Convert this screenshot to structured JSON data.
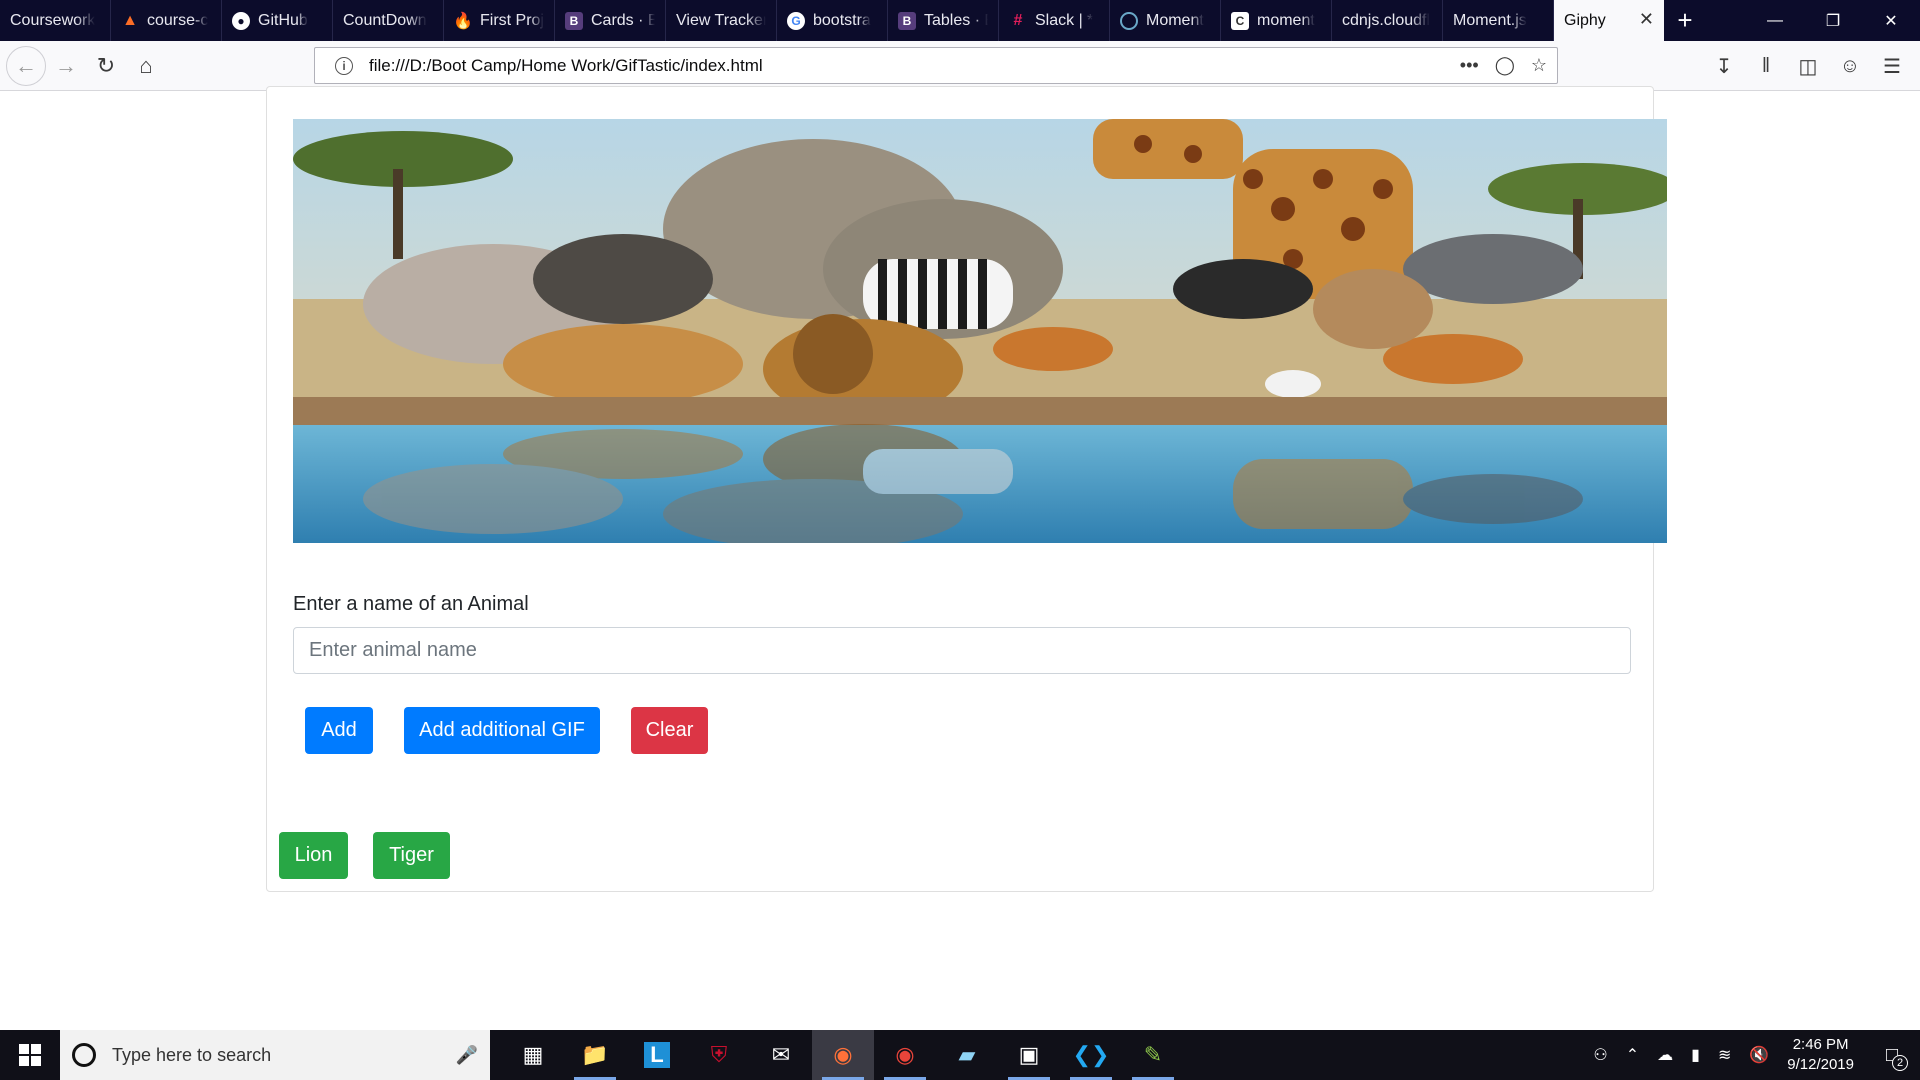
{
  "browser": {
    "tabs": [
      {
        "label": "Coursework",
        "icon": "none"
      },
      {
        "label": "course-c",
        "icon": "gitlab-icon"
      },
      {
        "label": "GitHub",
        "icon": "github-icon"
      },
      {
        "label": "CountDown",
        "icon": "none"
      },
      {
        "label": "First Proj",
        "icon": "firebase-icon"
      },
      {
        "label": "Cards · B",
        "icon": "bootstrap-icon"
      },
      {
        "label": "View Tracker",
        "icon": "none"
      },
      {
        "label": "bootstra",
        "icon": "google-icon"
      },
      {
        "label": "Tables · E",
        "icon": "bootstrap-icon"
      },
      {
        "label": "Slack | *",
        "icon": "slack-icon"
      },
      {
        "label": "Moment",
        "icon": "clock-icon"
      },
      {
        "label": "moment",
        "icon": "c-icon"
      },
      {
        "label": "cdnjs.cloudfl",
        "icon": "none"
      },
      {
        "label": "Moment.js",
        "icon": "none"
      }
    ],
    "active_tab": {
      "label": "Giphy"
    },
    "url": "file:///D:/Boot Camp/Home Work/GifTastic/index.html"
  },
  "page": {
    "form": {
      "label": "Enter a name of an Animal",
      "placeholder": "Enter animal name",
      "add_label": "Add",
      "add_more_label": "Add additional GIF",
      "clear_label": "Clear"
    },
    "animal_buttons": [
      "Lion",
      "Tiger"
    ]
  },
  "taskbar": {
    "search_placeholder": "Type here to search",
    "time": "2:46 PM",
    "date": "9/12/2019",
    "notification_count": "2"
  },
  "colors": {
    "primary": "#007bff",
    "danger": "#dc3545",
    "success": "#28a745",
    "tabstrip": "#0c0c2b"
  }
}
